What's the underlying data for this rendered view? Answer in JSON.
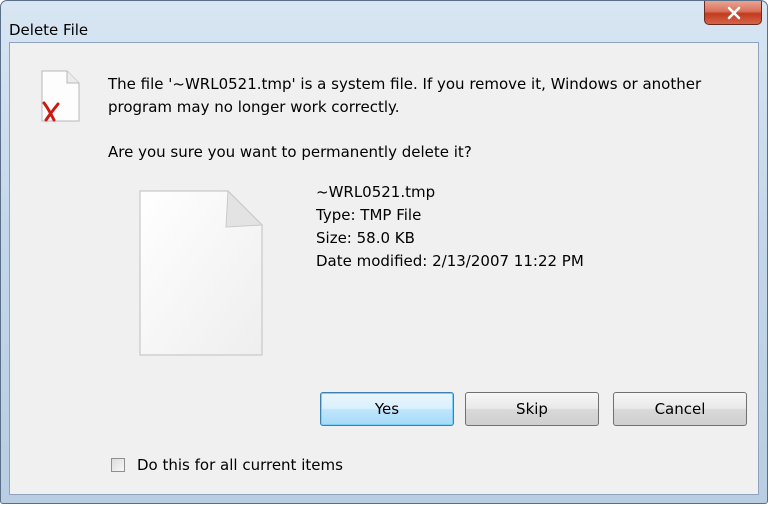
{
  "window": {
    "title": "Delete File"
  },
  "dialog": {
    "message": "The file '~WRL0521.tmp' is a system file. If you remove it, Windows or another program may no longer work correctly.",
    "question": "Are you sure you want to permanently delete it?",
    "file": {
      "name": "~WRL0521.tmp",
      "type": "Type: TMP File",
      "size": "Size: 58.0 KB",
      "date_modified": "Date modified: 2/13/2007 11:22 PM"
    },
    "buttons": {
      "yes": "Yes",
      "skip": "Skip",
      "cancel": "Cancel"
    },
    "apply_all": {
      "label": "Do this for all current items",
      "checked": false
    }
  },
  "icons": {
    "close": "close-icon",
    "warning": "system-file-warning-icon",
    "file": "file-icon"
  },
  "colors": {
    "close_button": "#c23b1c",
    "default_button_border": "#3c7fb1",
    "dialog_background": "#f0f0f0"
  }
}
